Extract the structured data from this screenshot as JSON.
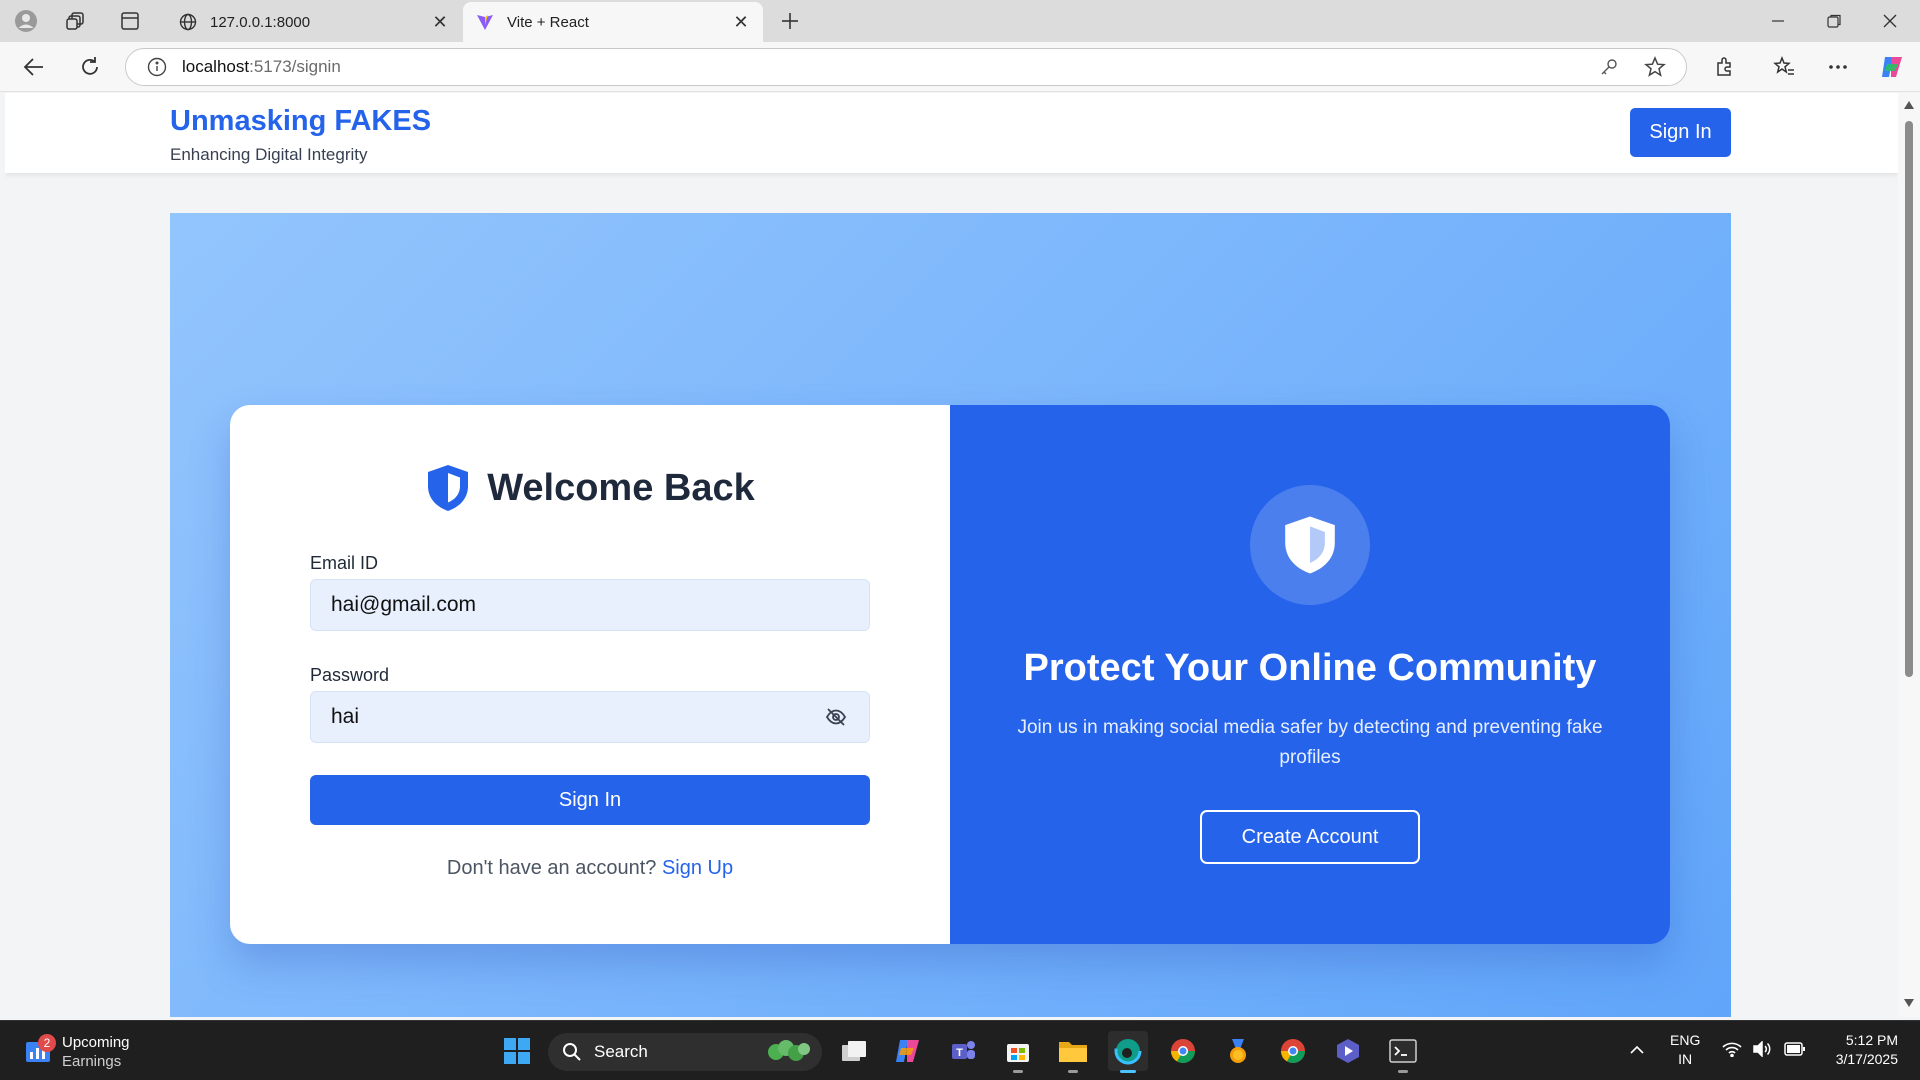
{
  "browser": {
    "tabs": [
      {
        "title": "127.0.0.1:8000",
        "active": false
      },
      {
        "title": "Vite + React",
        "active": true
      }
    ],
    "address": {
      "host": "localhost",
      "path": ":5173/signin"
    }
  },
  "header": {
    "brand_title": "Unmasking FAKES",
    "brand_subtitle": "Enhancing Digital Integrity",
    "signin_label": "Sign In"
  },
  "signin_form": {
    "heading": "Welcome Back",
    "email_label": "Email ID",
    "email_value": "hai@gmail.com",
    "password_label": "Password",
    "password_value": "hai",
    "submit_label": "Sign In",
    "signup_prompt": "Don't have an account?",
    "signup_link": "Sign Up"
  },
  "promo": {
    "title": "Protect Your Online Community",
    "description": "Join us in making social media safer by detecting and preventing fake profiles",
    "cta_label": "Create Account"
  },
  "colors": {
    "primary": "#2563eb",
    "hero_gradient_start": "#93c5fd",
    "hero_gradient_end": "#60a5fa",
    "input_bg": "#e8f0fe"
  },
  "taskbar": {
    "weather": {
      "title": "Upcoming",
      "subtitle": "Earnings",
      "badge": "2"
    },
    "search_label": "Search",
    "language": "ENG",
    "region": "IN",
    "time": "5:12 PM",
    "date": "3/17/2025"
  }
}
